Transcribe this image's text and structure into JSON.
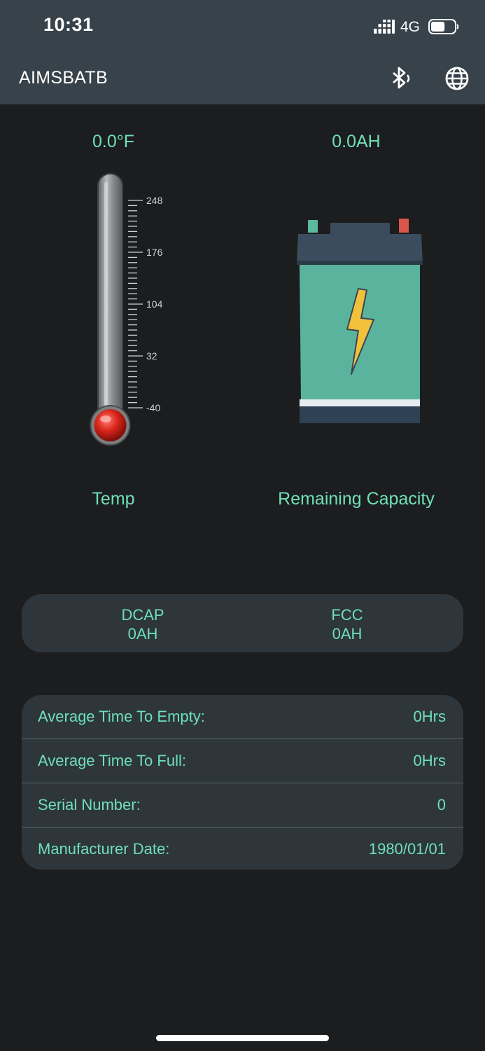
{
  "status_bar": {
    "time": "10:31",
    "network": "4G",
    "battery_level": 0.6
  },
  "header": {
    "title": "AIMSBATB",
    "bluetooth_icon": "bluetooth-icon",
    "language_icon": "globe-icon"
  },
  "temperature": {
    "value": "0.0°F",
    "label": "Temp",
    "scale_ticks": [
      "248",
      "176",
      "104",
      "32",
      "-40"
    ]
  },
  "capacity": {
    "value": "0.0AH",
    "label": "Remaining Capacity"
  },
  "capacity_summary": {
    "dcap": {
      "label": "DCAP",
      "value": "0AH"
    },
    "fcc": {
      "label": "FCC",
      "value": "0AH"
    }
  },
  "info": {
    "rows": [
      {
        "label": "Average Time To Empty:",
        "value": "0Hrs"
      },
      {
        "label": "Average Time To Full:",
        "value": "0Hrs"
      },
      {
        "label": "Serial Number:",
        "value": "0"
      },
      {
        "label": "Manufacturer Date:",
        "value": "1980/01/01"
      }
    ]
  },
  "colors": {
    "accent": "#6fe0b9",
    "header_bg": "#37424a",
    "page_bg": "#1c1d1f",
    "card_bg": "#2e363b"
  }
}
